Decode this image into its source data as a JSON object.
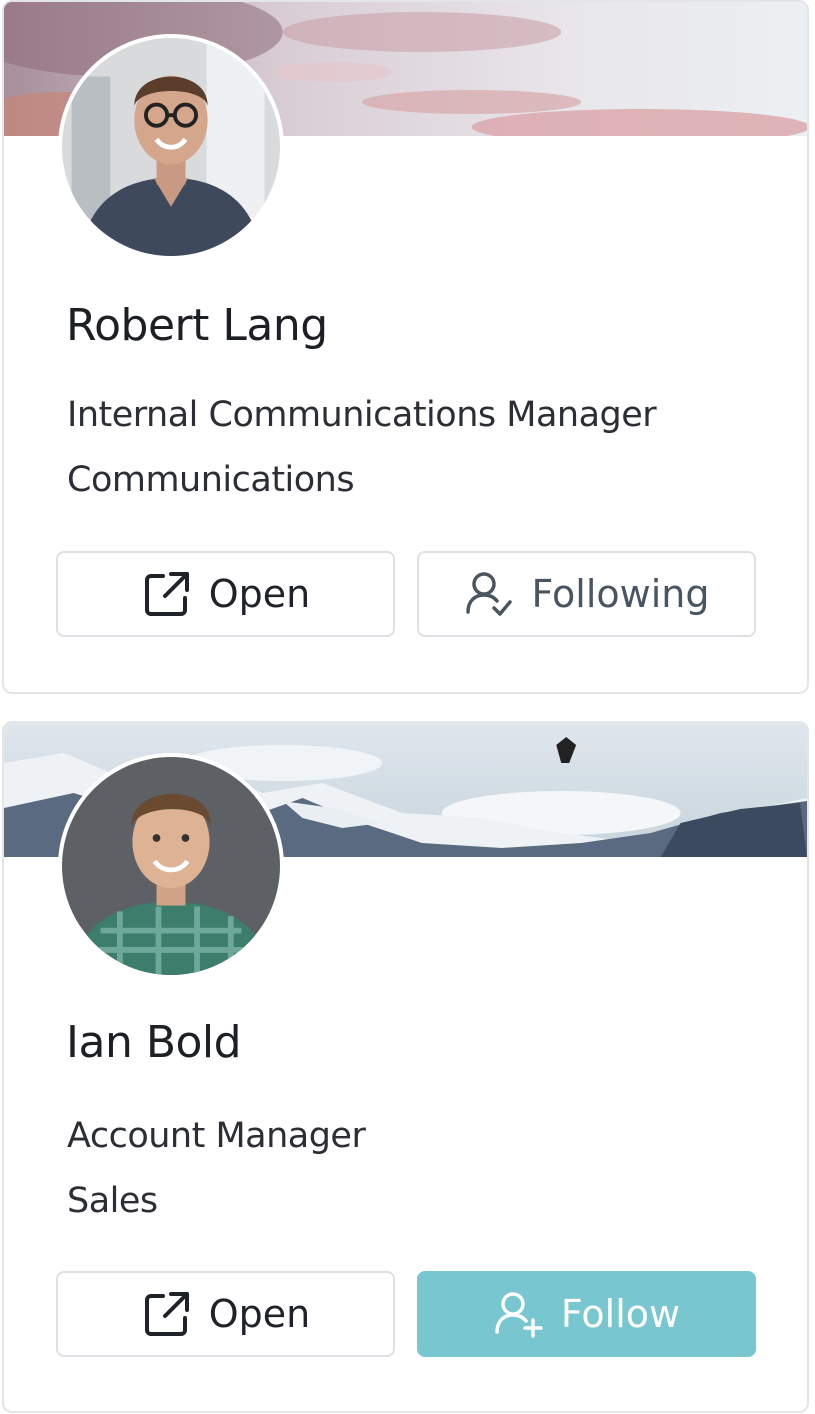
{
  "cards": [
    {
      "name": "Robert Lang",
      "title": "Internal Communications Manager",
      "department": "Communications",
      "open_label": "Open",
      "follow_label": "Following",
      "follow_state": "following",
      "cover": "sunset-clouds",
      "avatar_icon": "person-photo"
    },
    {
      "name": "Ian Bold",
      "title": "Account Manager",
      "department": "Sales",
      "open_label": "Open",
      "follow_label": "Follow",
      "follow_state": "not-following",
      "cover": "snowy-mountains",
      "avatar_icon": "person-photo"
    }
  ],
  "colors": {
    "primary": "#78c6d0",
    "border": "#dde0e4",
    "text": "#1f2329"
  }
}
